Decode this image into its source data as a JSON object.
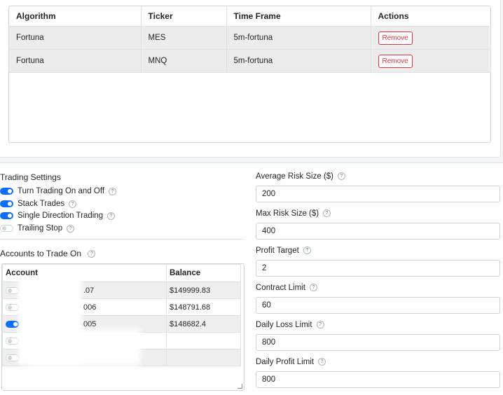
{
  "algorithms_table": {
    "headers": [
      "Algorithm",
      "Ticker",
      "Time Frame",
      "Actions"
    ],
    "rows": [
      {
        "algorithm": "Fortuna",
        "ticker": "MES",
        "time_frame": "5m-fortuna",
        "action": "Remove"
      },
      {
        "algorithm": "Fortuna",
        "ticker": "MNQ",
        "time_frame": "5m-fortuna",
        "action": "Remove"
      }
    ]
  },
  "trading_settings": {
    "title": "Trading Settings",
    "toggles": [
      {
        "label": "Turn Trading On and Off",
        "on": true
      },
      {
        "label": "Stack Trades",
        "on": true
      },
      {
        "label": "Single Direction Trading",
        "on": true
      },
      {
        "label": "Trailing Stop",
        "on": false
      }
    ]
  },
  "accounts": {
    "title": "Accounts to Trade On",
    "headers": [
      "Account",
      "Balance"
    ],
    "rows": [
      {
        "on": false,
        "account": ".07",
        "balance": "$149999.83"
      },
      {
        "on": false,
        "account": "006",
        "balance": "$148791.68"
      },
      {
        "on": true,
        "account": "005",
        "balance": "$148682.4"
      },
      {
        "on": false,
        "account": "",
        "balance": ""
      },
      {
        "on": false,
        "account": "",
        "balance": ""
      }
    ]
  },
  "fields": [
    {
      "label": "Average Risk Size ($)",
      "value": "200"
    },
    {
      "label": "Max Risk Size ($)",
      "value": "400"
    },
    {
      "label": "Profit Target",
      "value": "2"
    },
    {
      "label": "Contract Limit",
      "value": "60"
    },
    {
      "label": "Daily Loss Limit",
      "value": "800"
    },
    {
      "label": "Daily Profit Limit",
      "value": "800"
    }
  ],
  "colors": {
    "accent": "#0d6efd",
    "danger": "#dc3545"
  }
}
